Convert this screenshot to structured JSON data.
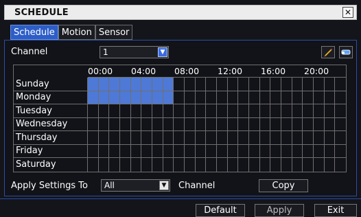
{
  "window": {
    "title": "SCHEDULE"
  },
  "tabs": [
    {
      "label": "Schedule",
      "active": true
    },
    {
      "label": "Motion",
      "active": false
    },
    {
      "label": "Sensor",
      "active": false
    }
  ],
  "channel": {
    "label": "Channel",
    "value": "1"
  },
  "schedule": {
    "hour_labels": [
      "00:00",
      "04:00",
      "08:00",
      "12:00",
      "16:00",
      "20:00"
    ],
    "days": [
      "Sunday",
      "Monday",
      "Tuesday",
      "Wednesday",
      "Thursday",
      "Friday",
      "Saturday"
    ],
    "selected_hours": {
      "Sunday": [
        0,
        1,
        2,
        3,
        4,
        5,
        6,
        7
      ],
      "Monday": [
        0,
        1,
        2,
        3,
        4,
        5,
        6,
        7
      ]
    },
    "cells_per_day": 24
  },
  "apply_settings": {
    "label": "Apply Settings To",
    "value": "All",
    "suffix": "Channel",
    "copy_label": "Copy"
  },
  "footer": {
    "default_label": "Default",
    "apply_label": "Apply",
    "exit_label": "Exit"
  },
  "icons": {
    "pencil": "pencil-icon",
    "eraser": "eraser-icon",
    "close": "close-icon"
  },
  "colors": {
    "selected": "#4e79d6",
    "accent": "#2d5ec7"
  }
}
